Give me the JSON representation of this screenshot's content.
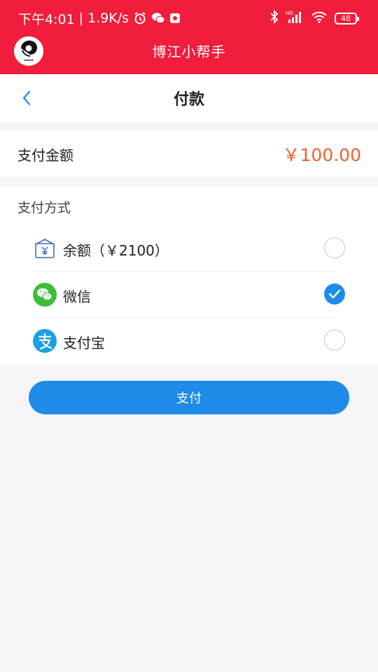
{
  "status_bar": {
    "time": "下午4:01",
    "separator": "|",
    "net_speed": "1.9K/s",
    "battery": "48",
    "icons": [
      "alarm-icon",
      "wechat-notify-icon",
      "app-notify-icon",
      "bluetooth-icon",
      "signal-icon",
      "wifi-icon",
      "battery-icon"
    ]
  },
  "app": {
    "title": "博江小帮手"
  },
  "nav": {
    "title": "付款",
    "back_icon": "chevron-left-icon"
  },
  "amount": {
    "label": "支付金额",
    "value": "￥100.00",
    "color": "#e8642c"
  },
  "payment": {
    "section_title": "支付方式",
    "methods": [
      {
        "label": "余额（￥2100）",
        "icon": "wallet-icon",
        "selected": false
      },
      {
        "label": "微信",
        "icon": "wechat-icon",
        "selected": true
      },
      {
        "label": "支付宝",
        "icon": "alipay-icon",
        "selected": false
      }
    ]
  },
  "pay_button": {
    "label": "支付"
  },
  "colors": {
    "brand_red": "#f01d3c",
    "accent_blue": "#1e8be8",
    "wechat_green": "#3dbd3a",
    "alipay_blue": "#1aa0e6"
  }
}
